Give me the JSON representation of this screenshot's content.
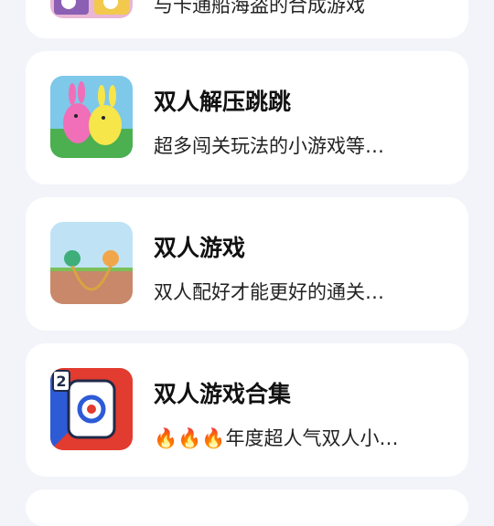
{
  "list": {
    "items": [
      {
        "title": "",
        "desc": "与卡通船海盗的合成游戏"
      },
      {
        "title": "双人解压跳跳",
        "desc": "超多闯关玩法的小游戏等…"
      },
      {
        "title": "双人游戏",
        "desc": "双人配好才能更好的通关…"
      },
      {
        "title": "双人游戏合集",
        "desc": "🔥🔥🔥年度超人气双人小…"
      }
    ]
  },
  "icons": {
    "thumb1": "cartoon-ship-game-icon",
    "thumb2": "pink-yellow-bunnies-icon",
    "thumb3": "rope-creatures-icon",
    "thumb4": "two-player-curling-icon"
  }
}
